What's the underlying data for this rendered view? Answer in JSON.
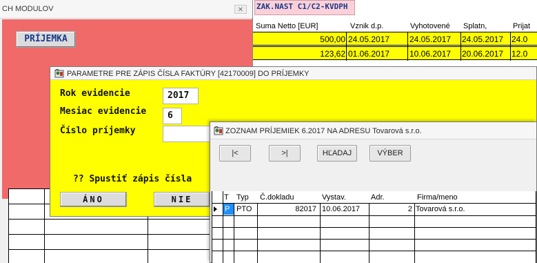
{
  "modulov": {
    "title": "CH MODULOV",
    "close_glyph": "✕",
    "prijemka_button": "PRÍJEMKA"
  },
  "doc_table": {
    "tag": "ZAK.NAST C1/C2-KVDPH",
    "columns": [
      "Suma Netto [EUR]",
      "Vznik d.p.",
      "Vyhotovené",
      "Splatn,",
      "Prijat"
    ],
    "rows": [
      {
        "suma": "500,00",
        "vznik": "24.05.2017",
        "vyhotovene": "24.05.2017",
        "splatn": "24.05.2017",
        "prijat": "24.0"
      },
      {
        "suma": "123,62",
        "vznik": "01.06.2017",
        "vyhotovene": "10.06.2017",
        "splatn": "20.06.2017",
        "prijat": "12.0"
      }
    ]
  },
  "parametre": {
    "title": "PARAMETRE PRE ZÁPIS ČÍSLA FAKTÚRY [42170009] DO PRÍJEMKY",
    "rok_label": "Rok evidencie",
    "rok_value": "2017",
    "mesiac_label": "Mesiac evidencie",
    "mesiac_value": "6",
    "cislo_label": "Číslo príjemky",
    "cislo_value": "",
    "question": "?? Spustiť zápis čísla",
    "ano_button": "ÁNO",
    "nie_button": "NIE"
  },
  "zoznam": {
    "title": "ZOZNAM PRÍJEMIEK 6.2017 NA ADRESU Tovarová s.r.o.",
    "buttons": {
      "first": "|<",
      "last": ">|",
      "search": "HĽADAJ",
      "select": "VÝBER"
    },
    "columns": {
      "t": "T",
      "typ": "Typ",
      "cdokladu": "Č.dokladu",
      "vystav": "Vystav.",
      "adr": "Adr.",
      "firma": "Firma/meno"
    },
    "rows": [
      {
        "t": "P",
        "typ": "PTO",
        "cdokladu": "82017",
        "vystav": "10.06.2017",
        "adr": "2",
        "firma": "Tovarová s.r.o."
      }
    ]
  },
  "colors": {
    "highlight_yellow": "#ffff00",
    "panel_red": "#f06a6a",
    "selection_blue": "#1e90ff",
    "tag_pink": "#fbd0d8"
  },
  "icons": {
    "dialog_icon": "app-icon"
  }
}
